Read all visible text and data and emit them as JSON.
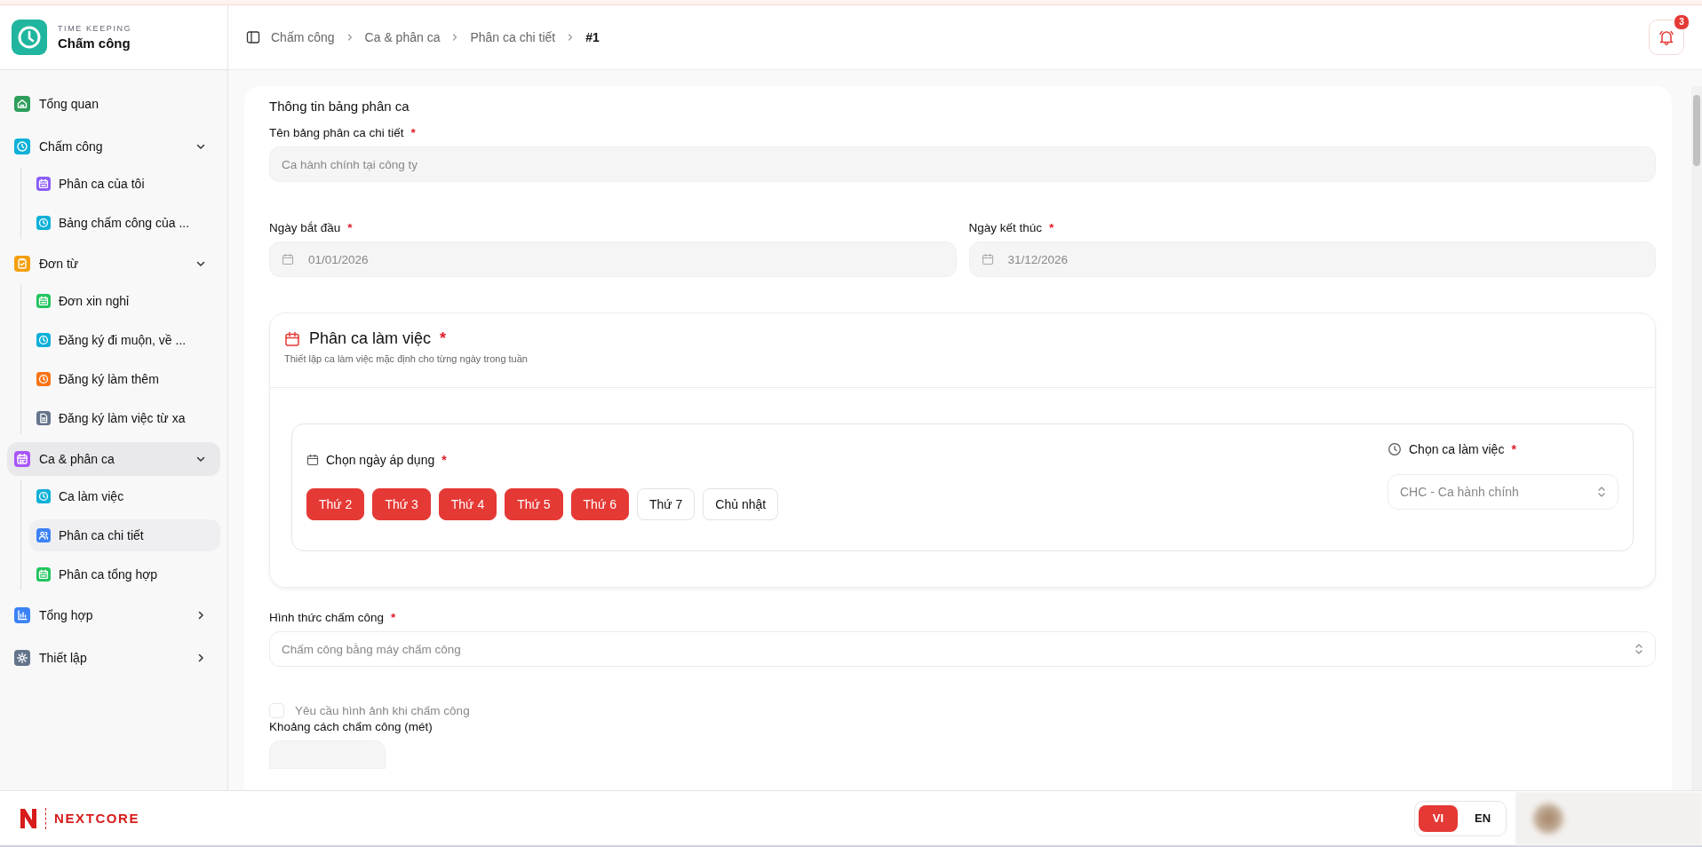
{
  "app": {
    "subtitle": "TIME KEEPING",
    "title": "Chấm công"
  },
  "sidebar": {
    "items": [
      {
        "label": "Tổng quan",
        "color": "#2e9e5b",
        "selected": false
      },
      {
        "label": "Chấm công",
        "color": "#0fb0d8",
        "selected": false,
        "expanded": true,
        "children": [
          {
            "label": "Phân ca của tôi",
            "color": "#8b5cf6",
            "selected": false
          },
          {
            "label": "Bảng chấm công của ...",
            "color": "#0fb0d8",
            "selected": false
          }
        ]
      },
      {
        "label": "Đơn từ",
        "color": "#f59e0b",
        "selected": false,
        "expanded": true,
        "children": [
          {
            "label": "Đơn xin nghỉ",
            "color": "#22c55e",
            "selected": false
          },
          {
            "label": "Đăng ký đi muộn, về ...",
            "color": "#0fb0d8",
            "selected": false
          },
          {
            "label": "Đăng ký làm thêm",
            "color": "#f97316",
            "selected": false
          },
          {
            "label": "Đăng ký làm việc từ xa",
            "color": "#64748b",
            "selected": false
          }
        ]
      },
      {
        "label": "Ca & phân ca",
        "color": "#a855f7",
        "selected": true,
        "expanded": true,
        "children": [
          {
            "label": "Ca làm việc",
            "color": "#0fb0d8",
            "selected": false
          },
          {
            "label": "Phân ca chi tiết",
            "color": "#3b82f6",
            "selected": true
          },
          {
            "label": "Phân ca tổng hợp",
            "color": "#22c55e",
            "selected": false
          }
        ]
      },
      {
        "label": "Tổng hợp",
        "color": "#3b82f6",
        "selected": false,
        "expanded": false
      },
      {
        "label": "Thiết lập",
        "color": "#64748b",
        "selected": false,
        "expanded": false
      }
    ]
  },
  "breadcrumb": [
    "Chấm công",
    "Ca & phân ca",
    "Phân ca chi tiết",
    "#1"
  ],
  "notifications": {
    "count": "3"
  },
  "form": {
    "title": "Thông tin bảng phân ca",
    "name": {
      "label": "Tên bảng phân ca chi tiết",
      "required": "*",
      "value": "Ca hành chính tại công ty"
    },
    "start": {
      "label": "Ngày bắt đầu",
      "required": "*",
      "value": "01/01/2026"
    },
    "end": {
      "label": "Ngày kết thúc",
      "required": "*",
      "value": "31/12/2026"
    },
    "shift_section": {
      "title": "Phân ca làm việc",
      "required": "*",
      "description": "Thiết lập ca làm việc mặc định cho từng ngày trong tuần",
      "days_label": "Chọn ngày áp dụng",
      "days_required": "*",
      "days": [
        {
          "label": "Thứ 2",
          "selected": true
        },
        {
          "label": "Thứ 3",
          "selected": true
        },
        {
          "label": "Thứ 4",
          "selected": true
        },
        {
          "label": "Thứ 5",
          "selected": true
        },
        {
          "label": "Thứ 6",
          "selected": true
        },
        {
          "label": "Thứ 7",
          "selected": false
        },
        {
          "label": "Chủ nhật",
          "selected": false
        }
      ],
      "shift_label": "Chọn ca làm việc",
      "shift_required": "*",
      "shift_value": "CHC - Ca hành chính"
    },
    "method": {
      "label": "Hình thức chấm công",
      "required": "*",
      "value": "Chấm công bằng máy chấm công"
    },
    "photo": {
      "label": "Yêu cầu hình ảnh khi chấm công",
      "checked": false,
      "disabled": true
    },
    "distance": {
      "label": "Khoảng cách chấm công (mét)"
    }
  },
  "footer": {
    "brand": "NEXTCORE",
    "languages": [
      {
        "label": "VI",
        "selected": true
      },
      {
        "label": "EN",
        "selected": false
      }
    ]
  }
}
